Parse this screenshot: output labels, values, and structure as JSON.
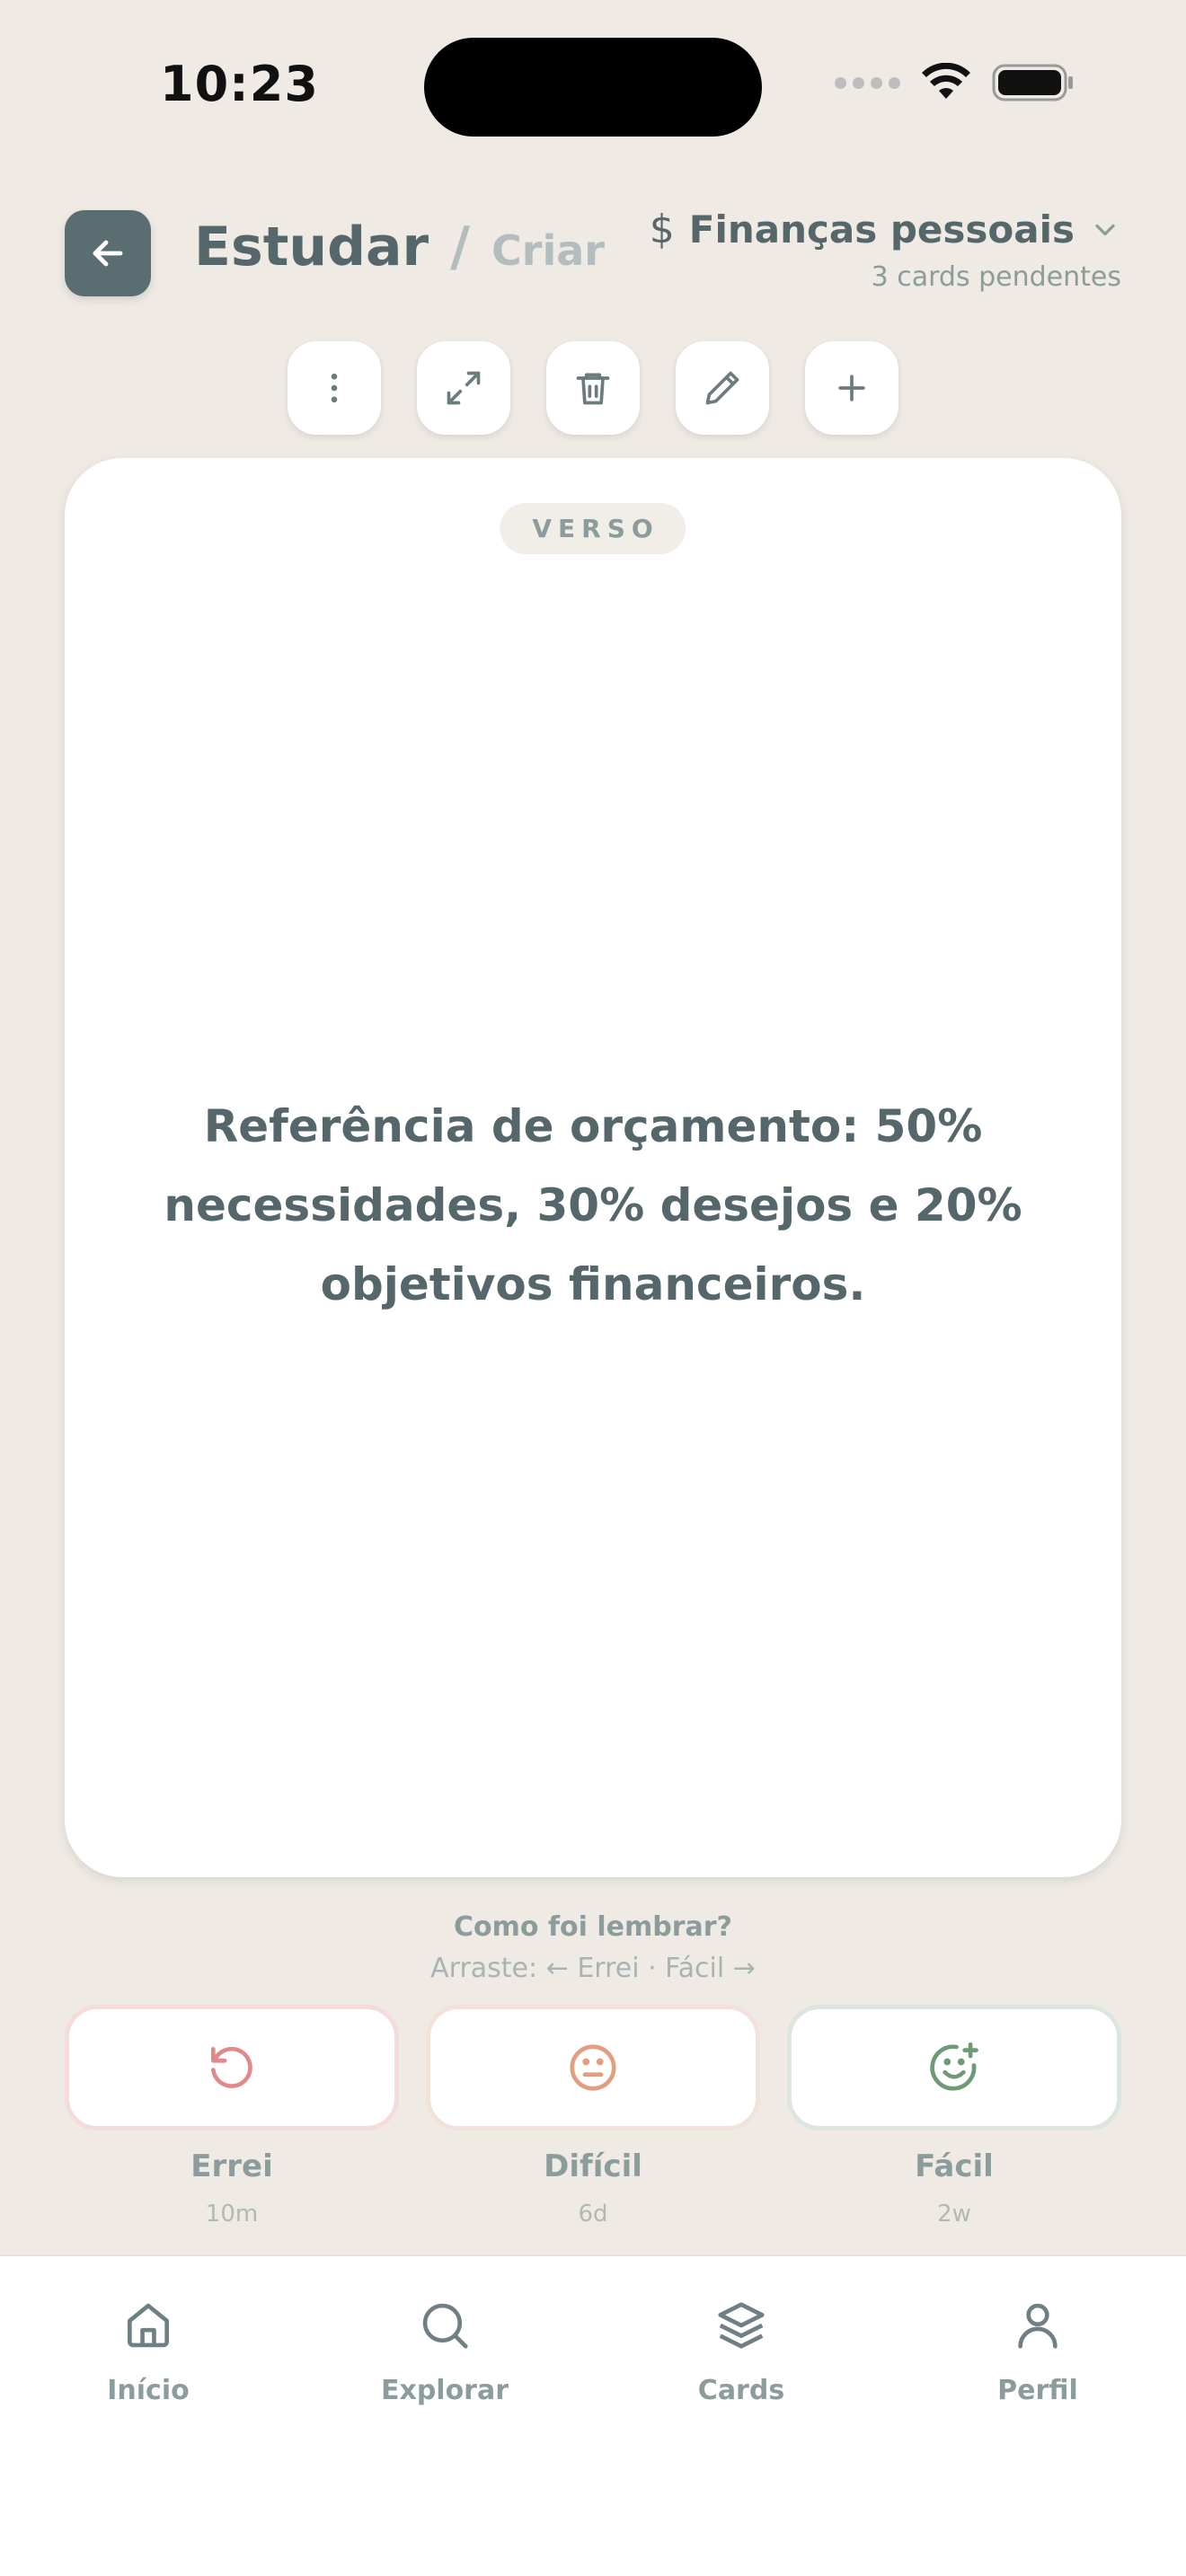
{
  "status_bar": {
    "time": "10:23"
  },
  "header": {
    "title": "Estudar",
    "separator": "/",
    "secondary": "Criar",
    "deck": {
      "icon": "dollar-icon",
      "icon_glyph": "$",
      "name": "Finanças pessoais",
      "pending": "3 cards pendentes"
    }
  },
  "toolbar": {
    "items": [
      {
        "name": "more-options-button",
        "icon": "more-vertical-icon"
      },
      {
        "name": "expand-button",
        "icon": "expand-icon"
      },
      {
        "name": "delete-button",
        "icon": "trash-icon"
      },
      {
        "name": "edit-button",
        "icon": "pencil-icon"
      },
      {
        "name": "add-button",
        "icon": "plus-icon"
      }
    ]
  },
  "card": {
    "side": "VERSO",
    "text": "Referência de orçamento: 50% necessidades, 30% desejos e 20% objetivos financeiros."
  },
  "review": {
    "prompt": "Como foi lembrar?",
    "hint": "Arraste: ← Errei · Fácil →",
    "answers": [
      {
        "label": "Errei",
        "interval": "10m",
        "icon": "undo-icon",
        "color": "#E0898A"
      },
      {
        "label": "Difícil",
        "interval": "6d",
        "icon": "neutral-face-icon",
        "color": "#E0A080"
      },
      {
        "label": "Fácil",
        "interval": "2w",
        "icon": "smile-plus-icon",
        "color": "#6E9A78"
      }
    ]
  },
  "nav": {
    "items": [
      {
        "label": "Início",
        "icon": "home-icon"
      },
      {
        "label": "Explorar",
        "icon": "search-icon"
      },
      {
        "label": "Cards",
        "icon": "layers-icon"
      },
      {
        "label": "Perfil",
        "icon": "user-icon"
      }
    ]
  },
  "colors": {
    "background": "#EFEBE4",
    "primary": "#5A6E72",
    "text": "#55676B",
    "muted": "#8C9C9C"
  }
}
